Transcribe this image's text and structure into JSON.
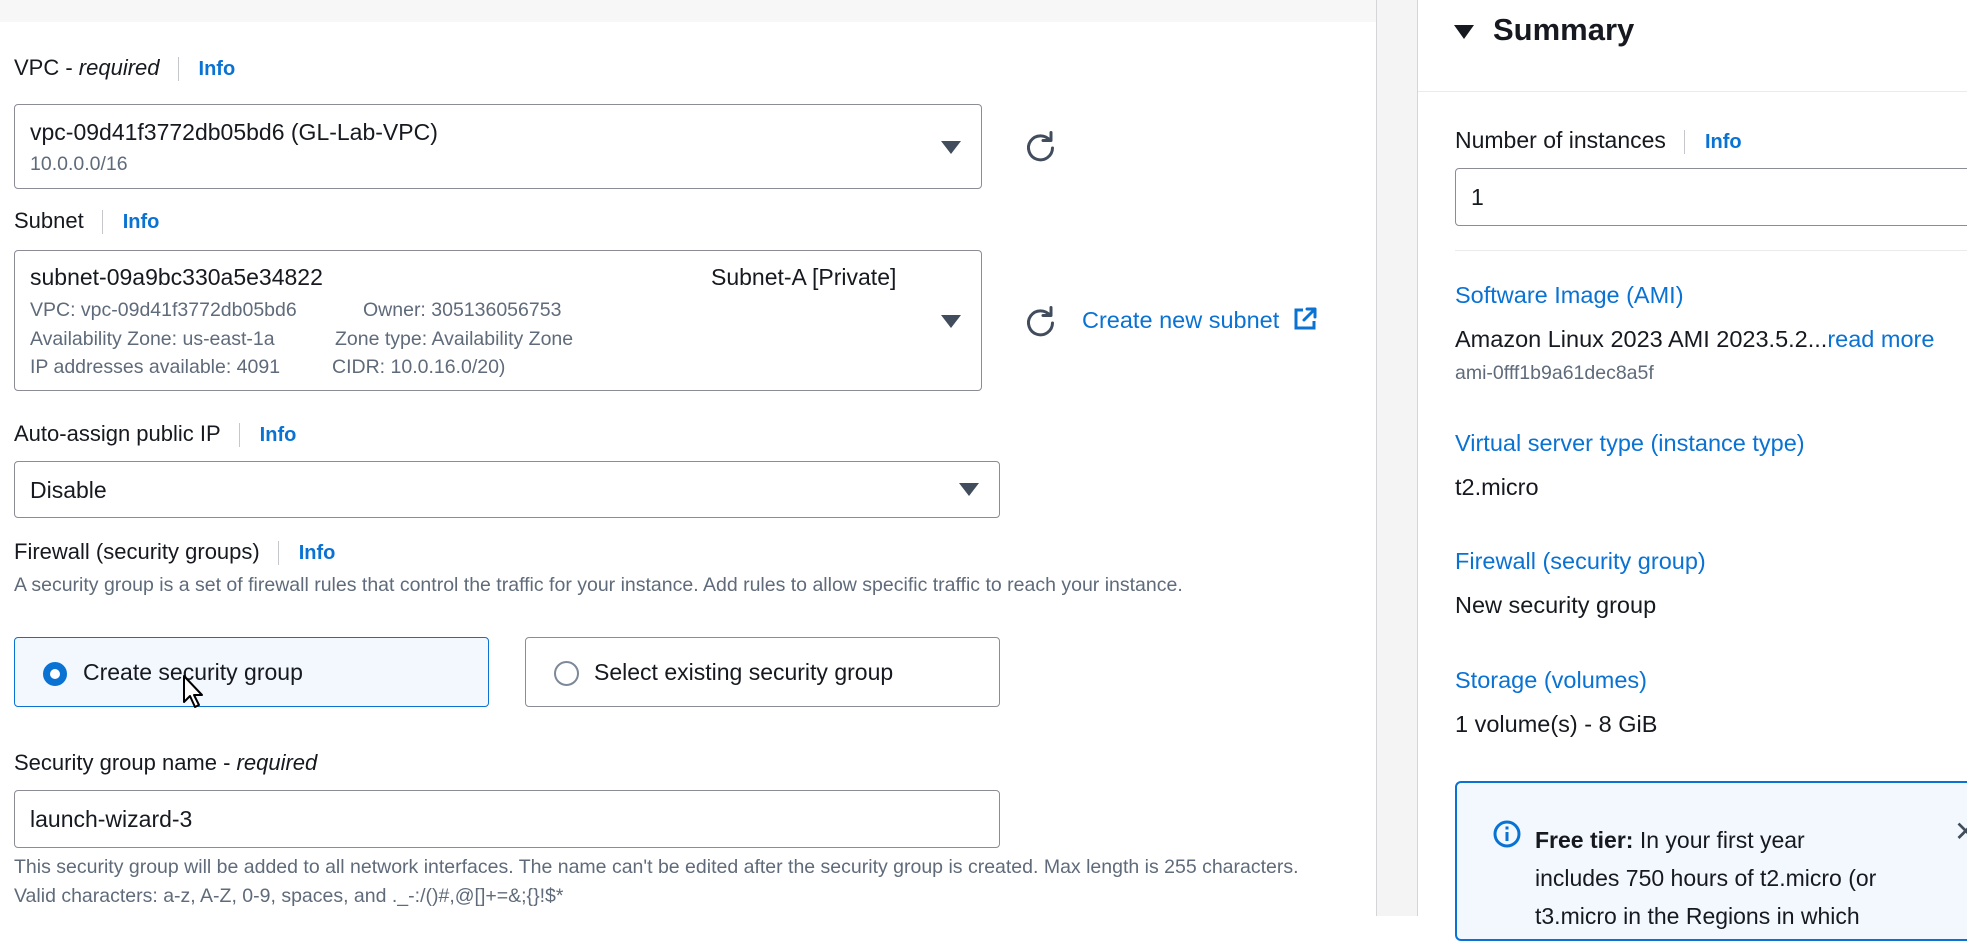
{
  "vpc": {
    "label": "VPC - ",
    "label_required": "required",
    "info": "Info",
    "selected_value": "vpc-09d41f3772db05bd6 (GL-Lab-VPC)",
    "selected_sub": "10.0.0.0/16"
  },
  "subnet": {
    "label": "Subnet",
    "info": "Info",
    "selected_value": "subnet-09a9bc330a5e34822",
    "selected_tag": "Subnet-A [Private]",
    "vpc_detail": "VPC: vpc-09d41f3772db05bd6",
    "owner_detail": "Owner: 305136056753",
    "az_detail": "Availability Zone: us-east-1a",
    "zone_type_detail": "Zone type: Availability Zone",
    "ip_detail": "IP addresses available: 4091",
    "cidr_detail": "CIDR: 10.0.16.0/20)",
    "create_link": "Create new subnet"
  },
  "auto_assign": {
    "label": "Auto-assign public IP",
    "info": "Info",
    "value": "Disable"
  },
  "firewall": {
    "label": "Firewall (security groups)",
    "info": "Info",
    "description": "A security group is a set of firewall rules that control the traffic for your instance. Add rules to allow specific traffic to reach your instance.",
    "option_create": "Create security group",
    "option_existing": "Select existing security group"
  },
  "sg_name": {
    "label": "Security group name - ",
    "label_required": "required",
    "value": "launch-wizard-3",
    "help": "This security group will be added to all network interfaces. The name can't be edited after the security group is created. Max length is 255 characters. Valid characters: a-z, A-Z, 0-9, spaces, and ._-:/()#,@[]+=&;{}!$*"
  },
  "summary": {
    "title": "Summary",
    "instances_label": "Number of instances",
    "instances_info": "Info",
    "instances_value": "1",
    "ami_label": "Software Image (AMI)",
    "ami_value": "Amazon Linux 2023 AMI 2023.5.2...",
    "ami_read_more": "read more",
    "ami_id": "ami-0fff1b9a61dec8a5f",
    "type_label": "Virtual server type (instance type)",
    "type_value": "t2.micro",
    "fw_label": "Firewall (security group)",
    "fw_value": "New security group",
    "storage_label": "Storage (volumes)",
    "storage_value": "1 volume(s) - 8 GiB",
    "free_tier_bold": "Free tier:",
    "free_tier_line1": " In your first year",
    "free_tier_line2": "includes 750 hours of t2.micro (or",
    "free_tier_line3": "t3.micro in the Regions in which"
  },
  "colors": {
    "link": "#0972d3",
    "selected_bg": "#f2f8fd",
    "border": "#8c8c94"
  }
}
